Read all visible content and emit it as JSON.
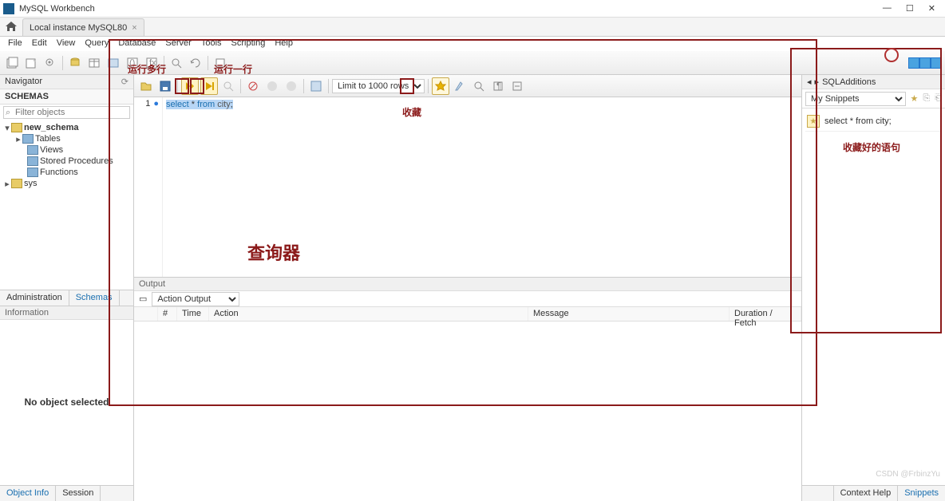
{
  "window": {
    "title": "MySQL Workbench"
  },
  "tab": {
    "label": "Local instance MySQL80",
    "close": "×"
  },
  "menu": [
    "File",
    "Edit",
    "View",
    "Query",
    "Database",
    "Server",
    "Tools",
    "Scripting",
    "Help"
  ],
  "nav": {
    "title": "Navigator",
    "schemas_label": "SCHEMAS",
    "filter_placeholder": "Filter objects",
    "tree": {
      "schema": "new_schema",
      "children": [
        "Tables",
        "Views",
        "Stored Procedures",
        "Functions"
      ],
      "other": "sys"
    },
    "tabs": {
      "admin": "Administration",
      "schemas": "Schemas"
    }
  },
  "info": {
    "title": "Information",
    "body": "No object selected",
    "tabs": {
      "obj": "Object Info",
      "sess": "Session"
    }
  },
  "editor": {
    "limit": "Limit to 1000 rows",
    "line_no": "1",
    "code": {
      "kw1": "select",
      "mid": " * ",
      "kw2": "from",
      "ident": " city",
      "semi": ";"
    }
  },
  "output": {
    "title": "Output",
    "selector": "Action Output",
    "cols": {
      "n": "#",
      "time": "Time",
      "action": "Action",
      "message": "Message",
      "dur": "Duration / Fetch"
    }
  },
  "sql_add": {
    "title": "SQLAdditions",
    "selector": "My Snippets",
    "snippet": "select * from city;",
    "tabs": {
      "help": "Context Help",
      "snip": "Snippets"
    }
  },
  "annot": {
    "run_many": "运行多行",
    "run_one": "运行一行",
    "fav": "收藏",
    "query_panel": "查询器",
    "fav_list": "收藏好的语句"
  },
  "watermark": "CSDN @FrbinzYu"
}
